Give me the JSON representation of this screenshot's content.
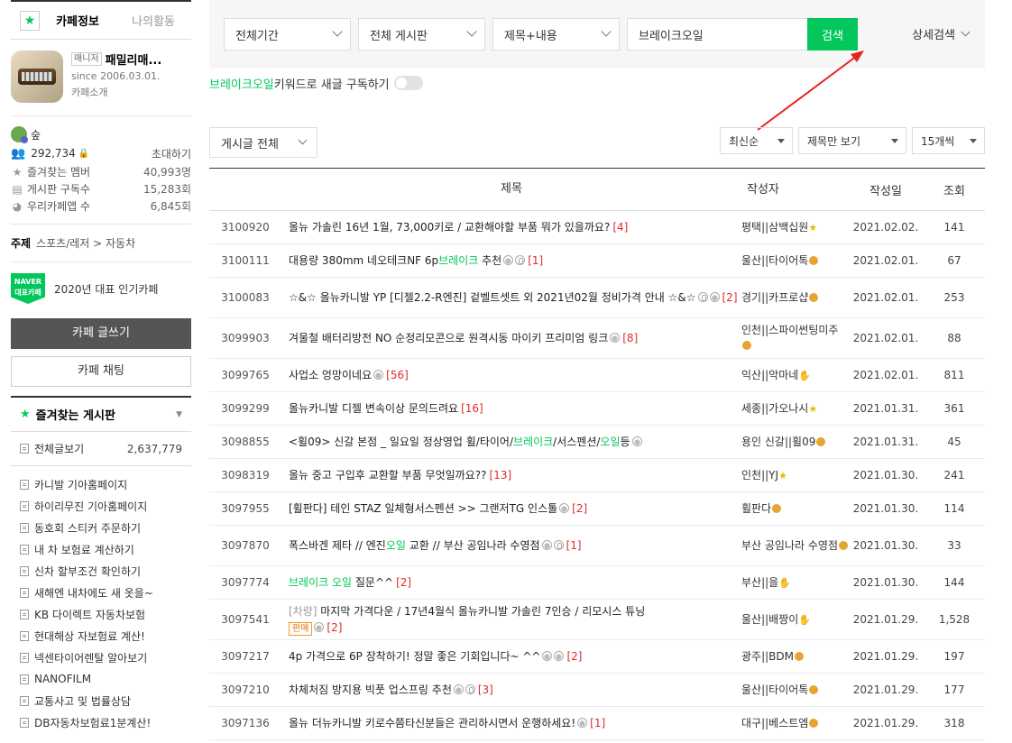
{
  "sidebar": {
    "tabs": {
      "cafe_info": "카페정보",
      "my_activity": "나의활동"
    },
    "cafe": {
      "manager_badge": "매니저",
      "name": "패밀리매...",
      "since": "since 2006.03.01.",
      "intro": "카페소개"
    },
    "level": "숲",
    "members": {
      "count": "292,734",
      "invite": "초대하기"
    },
    "stats": [
      {
        "label": "즐겨찾는 멤버",
        "value": "40,993명",
        "icon": "star-icon"
      },
      {
        "label": "게시판 구독수",
        "value": "15,283회",
        "icon": "board-icon"
      },
      {
        "label": "우리카페앱 수",
        "value": "6,845회",
        "icon": "app-icon"
      }
    ],
    "topic": {
      "label": "주제",
      "value": "스포츠/레저 > 자동차"
    },
    "award": {
      "badge_line1": "NAVER",
      "badge_line2": "대표카페",
      "text": "2020년 대표 인기카페"
    },
    "write_button": "카페 글쓰기",
    "chat_button": "카페 채팅",
    "favorites_title": "즐겨찾는 게시판",
    "all_posts": {
      "label": "전체글보기",
      "count": "2,637,779"
    },
    "menu": [
      "카니발 기아홈페이지",
      "하이리무진 기아홈페이지",
      "동호회 스티커 주문하기",
      "내 차 보험료 계산하기",
      "신차 할부조건 확인하기",
      "새해엔 내차에도 새 옷을~",
      "KB 다이렉트 자동차보험",
      "현대해상 자보험료 계산!",
      "넥센타이어렌탈 알아보기",
      "NANOFILM",
      "교통사고 및 법률상담",
      "DB자동차보험료1분계산!"
    ]
  },
  "search": {
    "period": "전체기간",
    "board": "전체 게시판",
    "scope": "제목+내용",
    "query": "브레이크오일",
    "button": "검색",
    "detail": "상세검색"
  },
  "subscribe": {
    "keyword": "브레이크오일",
    "text": " 키워드로 새글 구독하기"
  },
  "list_controls": {
    "filter": "게시글 전체",
    "order": "최신순",
    "view": "제목만 보기",
    "count": "15개씩"
  },
  "table": {
    "headers": {
      "title": "제목",
      "author": "작성자",
      "date": "작성일",
      "views": "조회"
    },
    "rows": [
      {
        "no": "3100920",
        "title": "올뉴 가솔린 16년 1월, 73,000키로 / 교환해야할 부품 뭐가 있을까요?",
        "comments": "[4]",
        "author": "평택||삼백십원",
        "date": "2021.02.02.",
        "views": "141"
      },
      {
        "no": "3100111",
        "title_pre": "대용량 380mm 네오테크NF 6p",
        "title_hl": "브레이크",
        "title_post": " 추천",
        "comments": "[1]",
        "author": "울산||타이어톡",
        "date": "2021.02.01.",
        "views": "67"
      },
      {
        "no": "3100083",
        "title": "☆&☆ 올뉴카니발 YP [디젤2.2-R엔진] 겉벨트셋트 외 2021년02월 정비가격 안내 ☆&☆",
        "comments": "[2]",
        "author": "경기||카프로샵",
        "date": "2021.02.01.",
        "views": "253"
      },
      {
        "no": "3099903",
        "title": "겨울철 배터리방전 NO 순정리모콘으로 원격시동 마이키 프리미엄 링크",
        "comments": "[8]",
        "author": "인천||스파이썬팅미주",
        "date": "2021.02.01.",
        "views": "88"
      },
      {
        "no": "3099765",
        "title": "사업소 엉망이네요",
        "comments": "[56]",
        "author": "익산||악마네",
        "date": "2021.02.01.",
        "views": "811"
      },
      {
        "no": "3099299",
        "title": "올뉴카니발 디젤 변속이상 문의드려요",
        "comments": "[16]",
        "author": "세종||가오나시",
        "date": "2021.01.31.",
        "views": "361"
      },
      {
        "no": "3098855",
        "title_pre": "<휠09> 신갈 본점 _ 일요일 정상영업 휠/타이어/",
        "title_hl": "브레이크",
        "title_mid": "/서스펜션/",
        "title_hl2": "오일",
        "title_post": "등",
        "comments": "",
        "author": "용인 신갈||휠09",
        "date": "2021.01.31.",
        "views": "45"
      },
      {
        "no": "3098319",
        "title": "올뉴 중고 구입후 교환할 부품 무엇일까요??",
        "comments": "[13]",
        "author": "인천||YJ",
        "date": "2021.01.30.",
        "views": "241"
      },
      {
        "no": "3097955",
        "title": "[휠판다] 테인 STAZ 일체형서스펜션 >> 그랜저TG 인스톨",
        "comments": "[2]",
        "author": "휠판다",
        "date": "2021.01.30.",
        "views": "114"
      },
      {
        "no": "3097870",
        "title_pre": "폭스바겐 제타 // 엔진",
        "title_hl": "오일",
        "title_post": " 교환 // 부산 공임나라 수영점",
        "comments": "[1]",
        "author": "부산 공임나라 수영점",
        "date": "2021.01.30.",
        "views": "33"
      },
      {
        "no": "3097774",
        "title_hl": "브레이크 오일",
        "title_post": " 질문^^",
        "comments": "[2]",
        "author": "부산||을",
        "date": "2021.01.30.",
        "views": "144"
      },
      {
        "no": "3097541",
        "prefix": "[차량]",
        "title": " 마지막 가격다운 / 17년4월식 올뉴카니발 가솔린 7인승 / 리모시스 튜닝",
        "badge": "판매",
        "comments": "[2]",
        "author": "울산||배짱이",
        "date": "2021.01.29.",
        "views": "1,528"
      },
      {
        "no": "3097217",
        "title": "4p 가격으로 6P 장착하기! 정말 좋은 기회입니다~ ^^",
        "comments": "[2]",
        "author": "광주||BDM",
        "date": "2021.01.29.",
        "views": "197"
      },
      {
        "no": "3097210",
        "title": "차체처짐 방지용 빅풋 업스프링 추천",
        "comments": "[3]",
        "author": "울산||타이어톡",
        "date": "2021.01.29.",
        "views": "177"
      },
      {
        "no": "3097136",
        "title": "올뉴 더뉴카니발 키로수쯤타신분들은 관리하시면서 운행하세요!",
        "comments": "[1]",
        "author": "대구||베스트엠",
        "date": "2021.01.29.",
        "views": "318"
      }
    ]
  },
  "colors": {
    "accent": "#03c75a",
    "comment": "#e02a2a",
    "arrow": "#e8231e"
  }
}
